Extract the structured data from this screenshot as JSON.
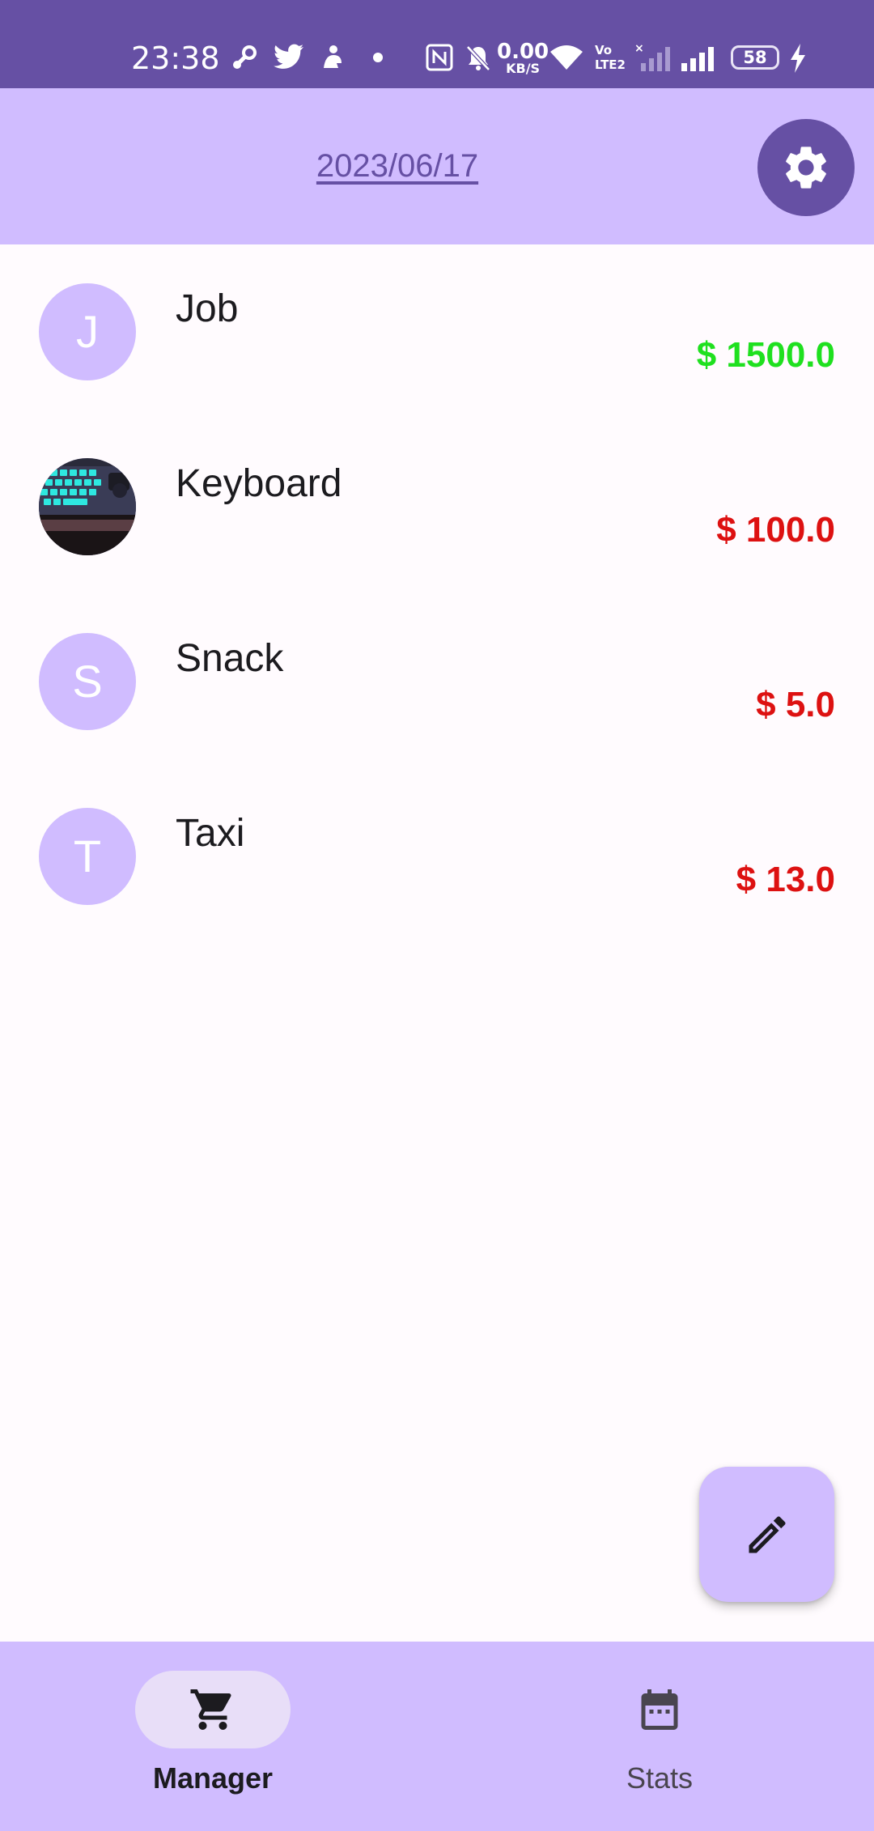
{
  "status_bar": {
    "time": "23:38",
    "network_speed_value": "0.00",
    "network_speed_unit": "KB/S",
    "volte": "Vo LTE2",
    "battery": "58",
    "background": "#6650A4",
    "icons": [
      "steam-icon",
      "twitter-icon",
      "notification-app-icon",
      "dot-icon",
      "nfc-icon",
      "mute-icon",
      "wifi-icon",
      "volte-icon",
      "signal-icon-sim1",
      "signal-icon-sim2",
      "battery-icon",
      "charging-icon"
    ]
  },
  "header": {
    "date": "2023/06/17",
    "settings_icon": "gear-icon",
    "background": "#D0BCFF",
    "accent": "#6650A4"
  },
  "transactions": [
    {
      "initial": "J",
      "name": "Job",
      "amount": "$ 1500.0",
      "type": "income",
      "avatar": "letter"
    },
    {
      "initial": "",
      "name": "Keyboard",
      "amount": "$ 100.0",
      "type": "expense",
      "avatar": "photo-keyboard"
    },
    {
      "initial": "S",
      "name": "Snack",
      "amount": "$ 5.0",
      "type": "expense",
      "avatar": "letter"
    },
    {
      "initial": "T",
      "name": "Taxi",
      "amount": "$ 13.0",
      "type": "expense",
      "avatar": "letter"
    }
  ],
  "colors": {
    "income": "#1FE01F",
    "expense": "#DD1111",
    "avatar_bg": "#D0BCFF"
  },
  "fab": {
    "icon": "pencil-icon"
  },
  "bottom_nav": {
    "items": [
      {
        "label": "Manager",
        "icon": "cart-icon",
        "active": true
      },
      {
        "label": "Stats",
        "icon": "calendar-icon",
        "active": false
      }
    ]
  }
}
